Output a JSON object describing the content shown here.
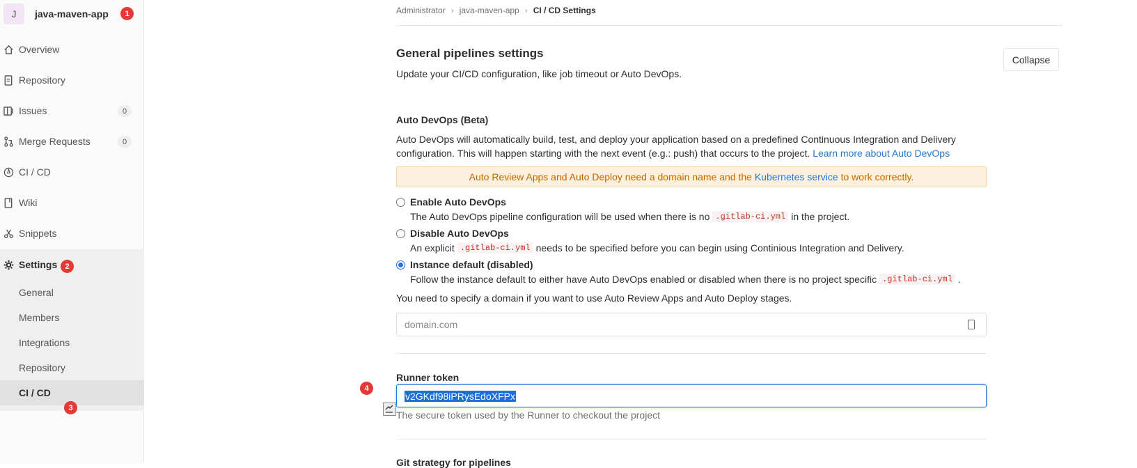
{
  "sidebar": {
    "avatar_letter": "J",
    "project_name": "java-maven-app",
    "items": [
      {
        "label": "Overview",
        "icon": "home-icon"
      },
      {
        "label": "Repository",
        "icon": "doc-icon"
      },
      {
        "label": "Issues",
        "icon": "issues-icon",
        "count": "0"
      },
      {
        "label": "Merge Requests",
        "icon": "merge-icon",
        "count": "0"
      },
      {
        "label": "CI / CD",
        "icon": "rocket-icon"
      },
      {
        "label": "Wiki",
        "icon": "book-icon"
      },
      {
        "label": "Snippets",
        "icon": "scissors-icon"
      },
      {
        "label": "Settings",
        "icon": "gear-icon"
      }
    ],
    "sub_items": [
      "General",
      "Members",
      "Integrations",
      "Repository",
      "CI / CD"
    ]
  },
  "annotations": {
    "b1": "1",
    "b2": "2",
    "b3": "3",
    "b4": "4"
  },
  "breadcrumb": {
    "a": "Administrator",
    "b": "java-maven-app",
    "c": "CI / CD Settings"
  },
  "section": {
    "title": "General pipelines settings",
    "subtitle": "Update your CI/CD configuration, like job timeout or Auto DevOps.",
    "collapse": "Collapse"
  },
  "devops": {
    "heading": "Auto DevOps (Beta)",
    "desc": "Auto DevOps will automatically build, test, and deploy your application based on a predefined Continuous Integration and Delivery configuration. This will happen starting with the next event (e.g.: push) that occurs to the project.",
    "learn_more": "Learn more about Auto DevOps",
    "warn_pre": "Auto Review Apps and Auto Deploy need a domain name and the",
    "warn_link": "Kubernetes service",
    "warn_post": "to work correctly.",
    "opt1_label": "Enable Auto DevOps",
    "opt1_pre": "The Auto DevOps pipeline configuration will be used when there is no",
    "opt1_code": ".gitlab-ci.yml",
    "opt1_post": "in the project.",
    "opt2_label": "Disable Auto DevOps",
    "opt2_pre": "An explicit",
    "opt2_code": ".gitlab-ci.yml",
    "opt2_post": "needs to be specified before you can begin using Continious Integration and Delivery.",
    "opt3_label": "Instance default (disabled)",
    "opt3_pre": "Follow the instance default to either have Auto DevOps enabled or disabled when there is no project specific",
    "opt3_code": ".gitlab-ci.yml",
    "opt3_post": ".",
    "domain_note": "You need to specify a domain if you want to use Auto Review Apps and Auto Deploy stages.",
    "domain_placeholder": "domain.com"
  },
  "runner": {
    "label": "Runner token",
    "token": "v2GKdf98iPRysEdoXFPx",
    "help": "The secure token used by the Runner to checkout the project"
  },
  "git_strategy": {
    "title": "Git strategy for pipelines"
  }
}
